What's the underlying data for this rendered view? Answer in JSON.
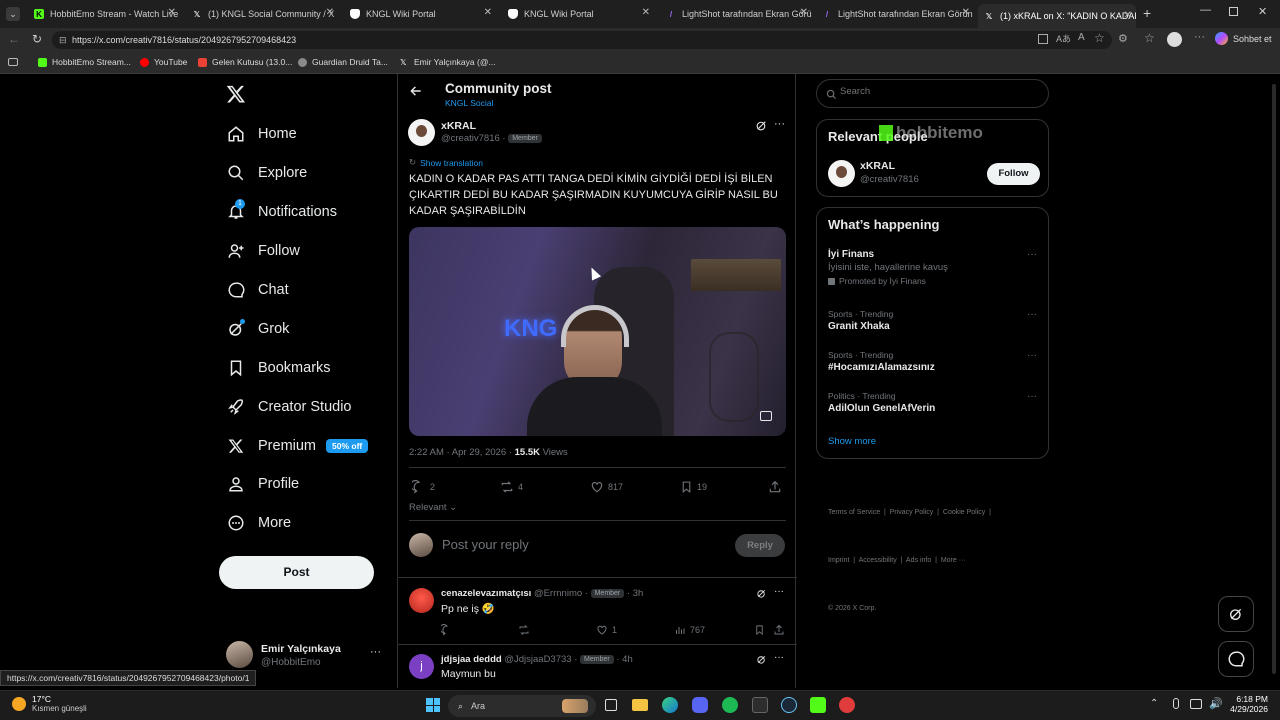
{
  "tabs": [
    {
      "title": "HobbitEmo Stream - Watch Live o",
      "icon_color": "#53fc18",
      "icon_glyph": "K"
    },
    {
      "title": "(1) KNGL Social Community / X",
      "icon_color": "#ffffff",
      "icon_glyph": "X"
    },
    {
      "title": "KNGL Wiki Portal",
      "icon_color": "#ffffff",
      "icon_glyph": "W"
    },
    {
      "title": "KNGL Wiki Portal",
      "icon_color": "#ffffff",
      "icon_glyph": "W"
    },
    {
      "title": "LightShot tarafından Ekran Görün",
      "icon_color": "#9b6bff",
      "icon_glyph": "/"
    },
    {
      "title": "LightShot tarafından Ekran Görün",
      "icon_color": "#9b6bff",
      "icon_glyph": "/"
    },
    {
      "title": "(1) xKRAL on X: \"KADIN O KADAR",
      "icon_color": "#ffffff",
      "icon_glyph": "X"
    }
  ],
  "address": {
    "url": "https://x.com/creativ7816/status/2049267952709468423",
    "chat_label": "Sohbet et"
  },
  "bookmarks": [
    {
      "label": "HobbitEmo Stream...",
      "color": "#53fc18"
    },
    {
      "label": "YouTube",
      "color": "#ff0000"
    },
    {
      "label": "Gelen Kutusu (13.0...",
      "color": "#ea4335"
    },
    {
      "label": "Guardian Druid Ta...",
      "color": "#8a8a8a"
    },
    {
      "label": "Emir Yalçınkaya (@...",
      "color": "#ffffff"
    }
  ],
  "nav": {
    "items": [
      {
        "label": "Home",
        "icon": "home-icon"
      },
      {
        "label": "Explore",
        "icon": "search-icon"
      },
      {
        "label": "Notifications",
        "icon": "bell-icon"
      },
      {
        "label": "Follow",
        "icon": "person-plus-icon"
      },
      {
        "label": "Chat",
        "icon": "chat-icon"
      },
      {
        "label": "Grok",
        "icon": "grok-icon"
      },
      {
        "label": "Bookmarks",
        "icon": "bookmark-icon"
      },
      {
        "label": "Creator Studio",
        "icon": "rocket-icon"
      },
      {
        "label": "Premium",
        "icon": "x-logo-icon"
      },
      {
        "label": "Profile",
        "icon": "person-icon"
      },
      {
        "label": "More",
        "icon": "more-circle-icon"
      }
    ],
    "notification_count": "1",
    "premium_badge": "50% off",
    "post_button": "Post",
    "account_name": "Emir Yalçınkaya",
    "account_handle": "@HobbitEmo"
  },
  "header": {
    "title": "Community post",
    "subtitle": "KNGL Social"
  },
  "post": {
    "author_name": "xKRAL",
    "author_handle": "@creativ7816",
    "member_badge": "Member",
    "show_translation": "Show translation",
    "text": "KADIN O KADAR PAS ATTI TANGA DEDİ KİMİN GİYDİĞİ DEDİ İŞİ BİLEN ÇIKARTIR DEDİ BU KADAR ŞAŞIRMADIN KUYUMCUYA GİRİP NASIL BU KADAR ŞAŞIRABİLDİN",
    "time": "2:22 AM · Apr 29, 2026 · ",
    "views_count": "15.5K",
    "views_label": " Views",
    "replies": "2",
    "reposts": "4",
    "likes": "817",
    "bookmarks": "19",
    "sort_label": "Relevant",
    "reply_placeholder": "Post your reply",
    "reply_button": "Reply"
  },
  "comments": [
    {
      "name": "cenazelevazımatçısı",
      "handle": "@Errnnimo",
      "badge": "Member",
      "age": "3h",
      "text": "Pp ne iş 🤣",
      "likes": "1",
      "views": "767"
    },
    {
      "name": "jdjsjaa deddd",
      "handle": "@JdjsjaaD3733",
      "badge": "Member",
      "age": "4h",
      "text": "Maymun bu"
    }
  ],
  "right": {
    "search_placeholder": "Search",
    "relevant_title": "Relevant people",
    "watermark": "hobbitemo",
    "person_name": "xKRAL",
    "person_handle": "@creativ7816",
    "follow_button": "Follow",
    "happening_title": "What’s happening",
    "promo_name": "İyi Finans",
    "promo_desc": "İyisini iste, hayallerine kavuş",
    "promo_by": "Promoted by İyi Finans",
    "trends": [
      {
        "category": "Sports · Trending",
        "name": "Granit Xhaka"
      },
      {
        "category": "Sports · Trending",
        "name": "#HocamızıAlamazsınız"
      },
      {
        "category": "Politics · Trending",
        "name": "AdilOlun GenelAfVerin"
      }
    ],
    "show_more": "Show more",
    "footer1": "Terms of Service  |  Privacy Policy  |  Cookie Policy  |",
    "footer2": "Imprint  |  Accessibility  |  Ads info  |  More ···",
    "footer3": "© 2026 X Corp."
  },
  "status_url": "https://x.com/creativ7816/status/2049267952709468423/photo/1",
  "taskbar": {
    "temp": "17°C",
    "weather": "Kısmen güneşli",
    "search": "Ara",
    "time": "6:18 PM",
    "date": "4/29/2026"
  }
}
